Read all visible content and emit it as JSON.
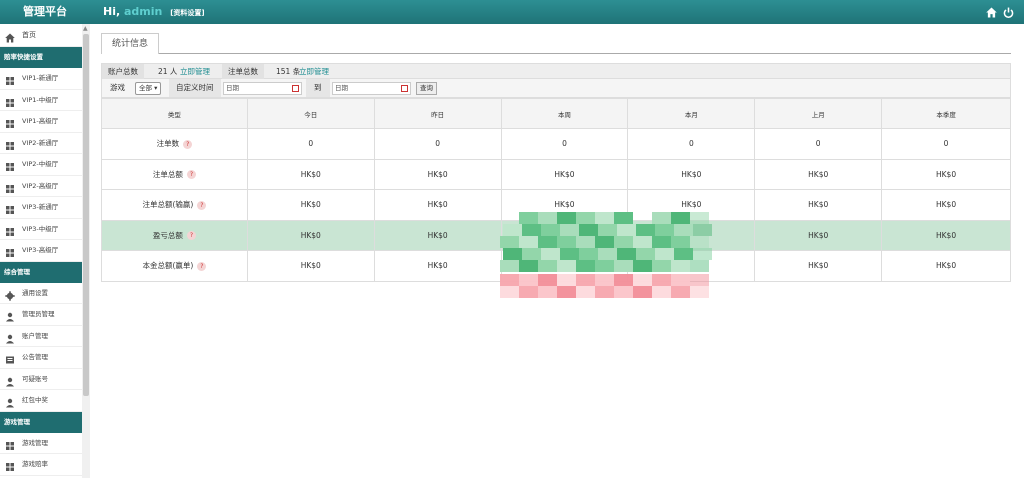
{
  "header": {
    "brand": "管理平台",
    "greeting": "Hi,",
    "username": "admin",
    "profile_link": "[资料设置]",
    "icons": [
      "home-icon",
      "power-icon"
    ]
  },
  "sidebar": {
    "home": "首页",
    "sections": [
      {
        "title": "赔率快捷设置",
        "items": [
          "VIP1-新通厅",
          "VIP1-中级厅",
          "VIP1-高级厅",
          "VIP2-新通厅",
          "VIP2-中级厅",
          "VIP2-高级厅",
          "VIP3-新通厅",
          "VIP3-中级厅",
          "VIP3-高级厅"
        ]
      },
      {
        "title": "综合管理",
        "items": [
          "通用设置",
          "管理员管理",
          "账户管理",
          "公告管理",
          "可疑账号",
          "红包中奖"
        ]
      },
      {
        "title": "游戏管理",
        "items": [
          "游戏管理",
          "游戏赔率"
        ]
      }
    ]
  },
  "main": {
    "tab": "统计信息",
    "stats": {
      "accounts_label": "账户总数",
      "accounts_value": "21 人",
      "accounts_link": "立即管理",
      "bets_label": "注单总数",
      "bets_value": "151 条",
      "bets_link": "立即管理"
    },
    "filter": {
      "game_label": "游戏",
      "game_selected": "全部",
      "custom_time_label": "自定义时间",
      "start_placeholder": "日期",
      "to_label": "到",
      "end_placeholder": "日期",
      "query_button": "查询"
    },
    "table": {
      "headers": [
        "类型",
        "今日",
        "昨日",
        "本周",
        "本月",
        "上月",
        "本季度"
      ],
      "rows": [
        {
          "label": "注单数",
          "values": [
            "0",
            "0",
            "0",
            "0",
            "0",
            "0"
          ]
        },
        {
          "label": "注单总额",
          "values": [
            "HK$0",
            "HK$0",
            "HK$0",
            "HK$0",
            "HK$0",
            "HK$0"
          ]
        },
        {
          "label": "注单总额(输赢)",
          "values": [
            "HK$0",
            "HK$0",
            "HK$0",
            "HK$0",
            "HK$0",
            "HK$0"
          ]
        },
        {
          "label": "盈亏总额",
          "values": [
            "HK$0",
            "HK$0",
            "",
            "",
            "HK$0",
            "HK$0"
          ]
        },
        {
          "label": "本金总额(赢单)",
          "values": [
            "HK$0",
            "HK$0",
            "",
            "",
            "HK$0",
            "HK$0"
          ]
        }
      ]
    },
    "colors": {
      "accent": "#1f7377",
      "highlight_row": "#c9e5d3"
    }
  }
}
